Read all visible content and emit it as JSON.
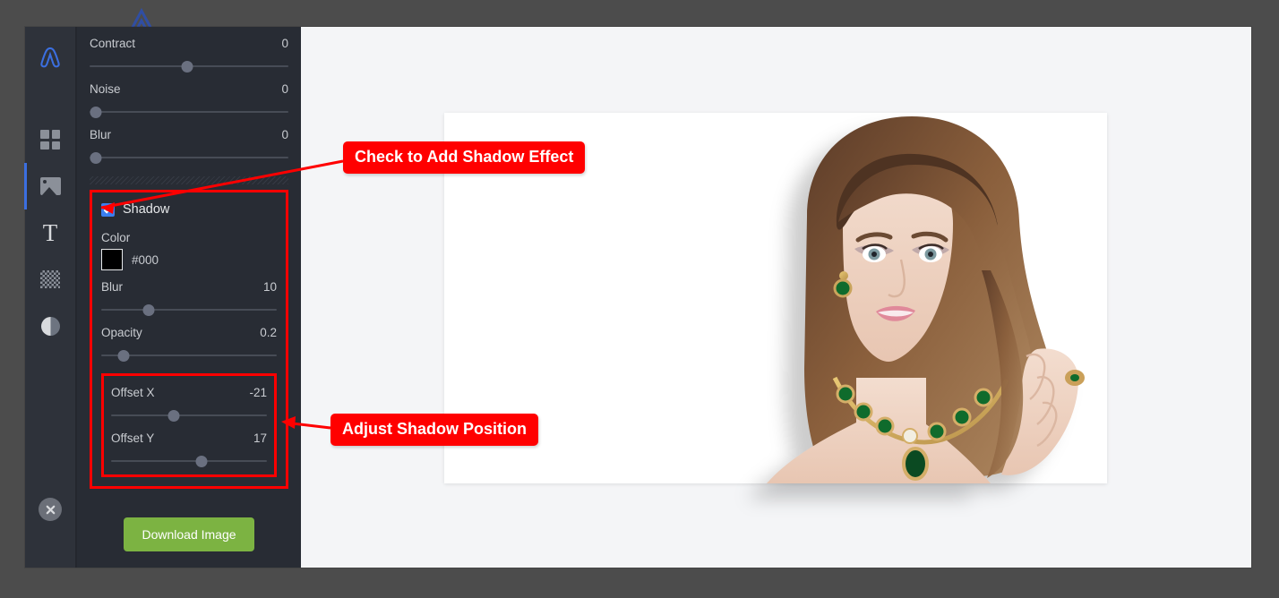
{
  "window": {
    "backdrop_color": "#4c4c4c",
    "canvas_bg": "#f4f5f7",
    "panel_bg": "#282c34",
    "rail_bg": "#2e323a"
  },
  "rail": {
    "logo_name": "app-logo",
    "accent_color": "#3b6fe0",
    "items": [
      {
        "name": "sidebar-item-templates",
        "icon": "grid-icon",
        "active": false
      },
      {
        "name": "sidebar-item-image",
        "icon": "image-icon",
        "active": true
      },
      {
        "name": "sidebar-item-text",
        "icon": "text-icon",
        "label": "T",
        "active": false
      },
      {
        "name": "sidebar-item-transparency",
        "icon": "checkerboard-icon",
        "active": false
      },
      {
        "name": "sidebar-item-adjust",
        "icon": "contrast-icon",
        "active": false
      }
    ],
    "close_button": {
      "name": "close-editor-button",
      "icon": "close-icon"
    }
  },
  "panel": {
    "top_sliders": [
      {
        "label": "Contract",
        "value": "0",
        "percent": 49
      },
      {
        "label": "Noise",
        "value": "0",
        "percent": 3
      },
      {
        "label": "Blur",
        "value": "0",
        "percent": 3
      }
    ],
    "shadow": {
      "title": "Shadow",
      "enabled": true,
      "checkbox_color": "#3b7ff0",
      "color_label": "Color",
      "color_value": "#000",
      "color_swatch": "#000000",
      "sliders": [
        {
          "label": "Blur",
          "value": "10",
          "percent": 27
        },
        {
          "label": "Opacity",
          "value": "0.2",
          "percent": 13
        }
      ],
      "offset_sliders": [
        {
          "label": "Offset X",
          "value": "-21",
          "percent": 40
        },
        {
          "label": "Offset Y",
          "value": "17",
          "percent": 58
        }
      ]
    },
    "download_label": "Download Image",
    "download_color": "#7cb342"
  },
  "annotations": {
    "color": "#ff0000",
    "shadow_callout": "Check to Add Shadow Effect",
    "offset_callout": "Adjust Shadow Position"
  },
  "photo": {
    "name": "portrait-photo",
    "shadow_offset_x": "-21",
    "shadow_offset_y": "17",
    "shadow_blur": "10",
    "shadow_opacity": "0.2"
  }
}
